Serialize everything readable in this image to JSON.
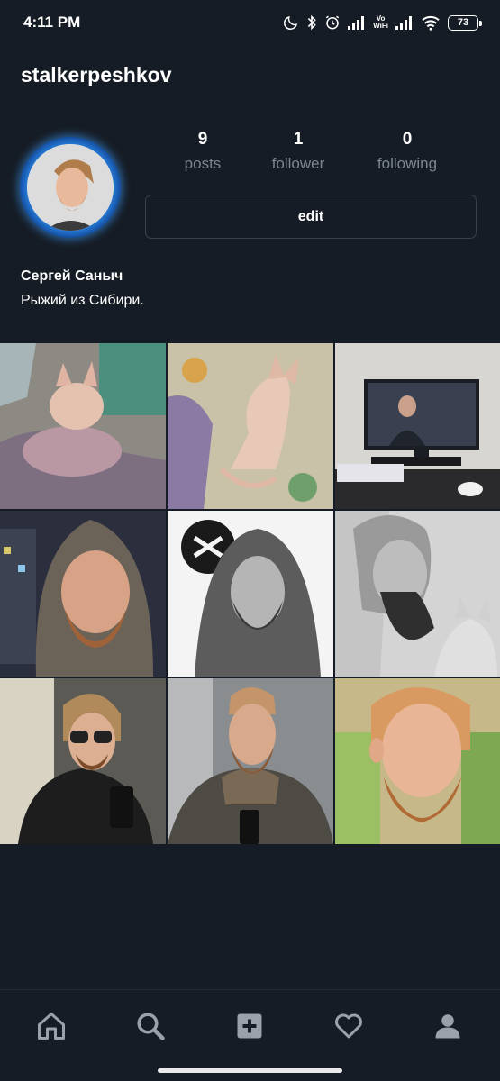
{
  "status_bar": {
    "time": "4:11 PM",
    "volte_top": "Vo",
    "volte_bottom": "WiFi",
    "battery": "73",
    "icons": [
      "moon-icon",
      "bluetooth-icon",
      "alarm-icon",
      "signal-icon",
      "volte-wifi-icon",
      "signal-icon",
      "wifi-icon",
      "battery-icon"
    ]
  },
  "profile": {
    "username": "stalkerpeshkov",
    "full_name": "Сергей Саныч",
    "bio": "Рыжий из Сибири.",
    "stats": [
      {
        "value": "9",
        "label": "posts"
      },
      {
        "value": "1",
        "label": "follower"
      },
      {
        "value": "0",
        "label": "following"
      }
    ],
    "edit_label": "edit"
  },
  "posts": [
    {
      "subject": "sphynx cat in blanket"
    },
    {
      "subject": "sphynx cat on bedspread"
    },
    {
      "subject": "monitor on desk"
    },
    {
      "subject": "man in hood"
    },
    {
      "subject": "black and white portrait in hood"
    },
    {
      "subject": "profile portrait with cat"
    },
    {
      "subject": "selfie with sunglasses"
    },
    {
      "subject": "mirror selfie"
    },
    {
      "subject": "portrait with beard"
    }
  ],
  "bottom_nav": {
    "items": [
      "home-icon",
      "search-icon",
      "add-post-icon",
      "heart-icon",
      "profile-icon"
    ]
  },
  "colors": {
    "background": "#161c25",
    "muted_text": "#7c8591",
    "border": "#39414d",
    "avatar_ring": "#2e8ff0"
  }
}
